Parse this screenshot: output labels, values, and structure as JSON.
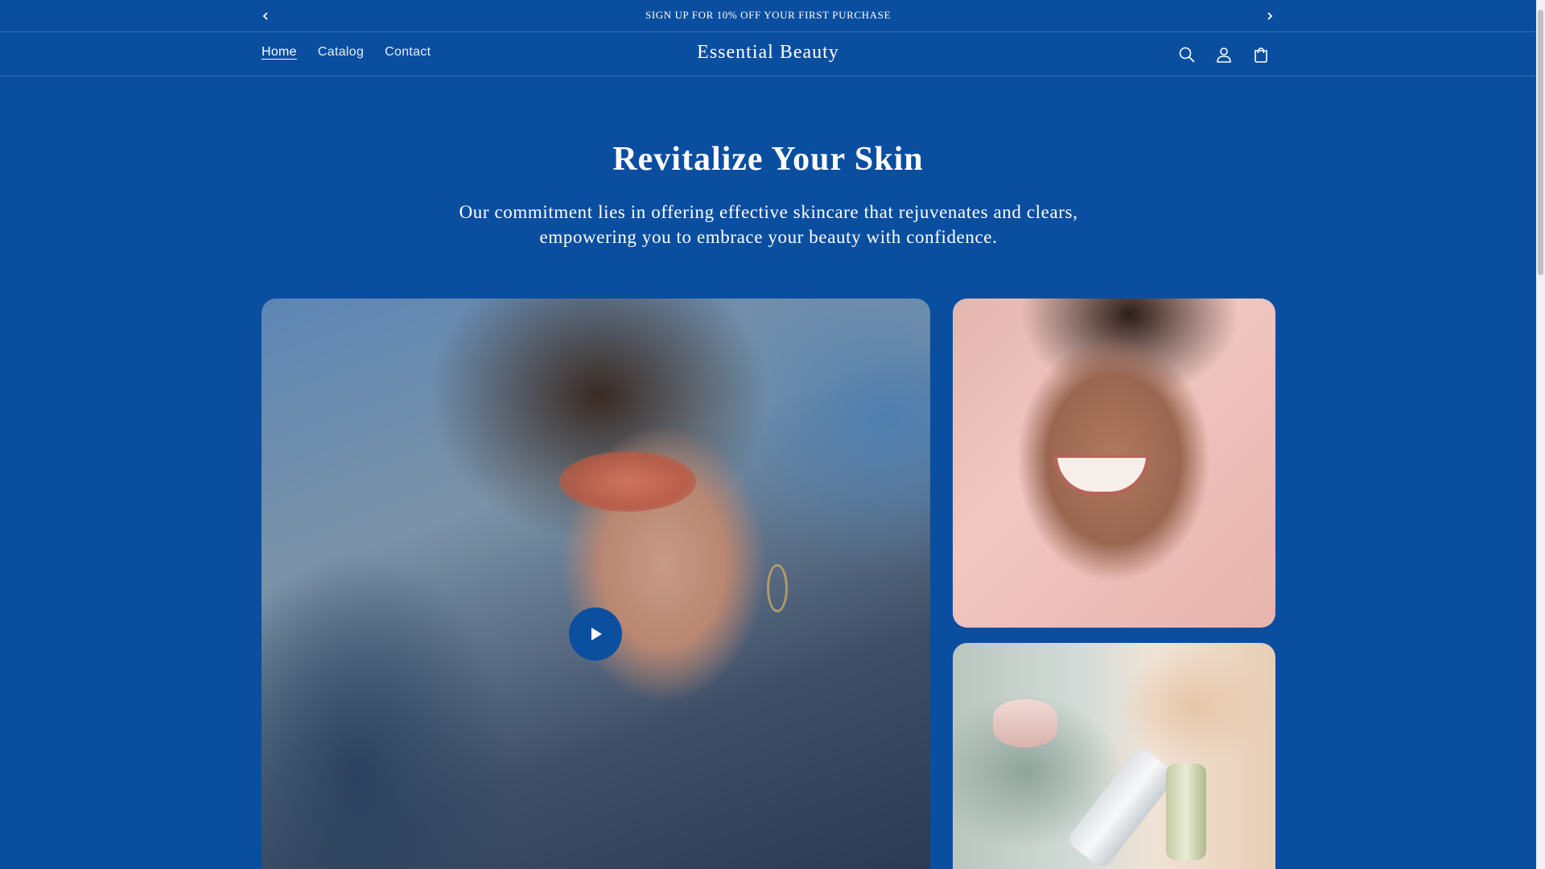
{
  "announcement": {
    "text": "SIGN UP FOR 10% OFF YOUR FIRST PURCHASE",
    "prev_icon": "chevron-left-icon",
    "next_icon": "chevron-right-icon"
  },
  "header": {
    "logo": "Essential Beauty",
    "nav": [
      {
        "label": "Home",
        "active": true
      },
      {
        "label": "Catalog",
        "active": false
      },
      {
        "label": "Contact",
        "active": false
      }
    ],
    "icons": [
      "search-icon",
      "account-icon",
      "cart-icon"
    ]
  },
  "hero": {
    "title": "Revitalize Your Skin",
    "subtitle": "Our commitment lies in offering effective skincare that rejuvenates and clears, empowering you to embrace your beauty with confidence."
  },
  "media": {
    "play_icon": "play-icon"
  },
  "colors": {
    "background": "#0a4ea0",
    "text": "#ffffff",
    "play_button": "#0b4f9f"
  }
}
